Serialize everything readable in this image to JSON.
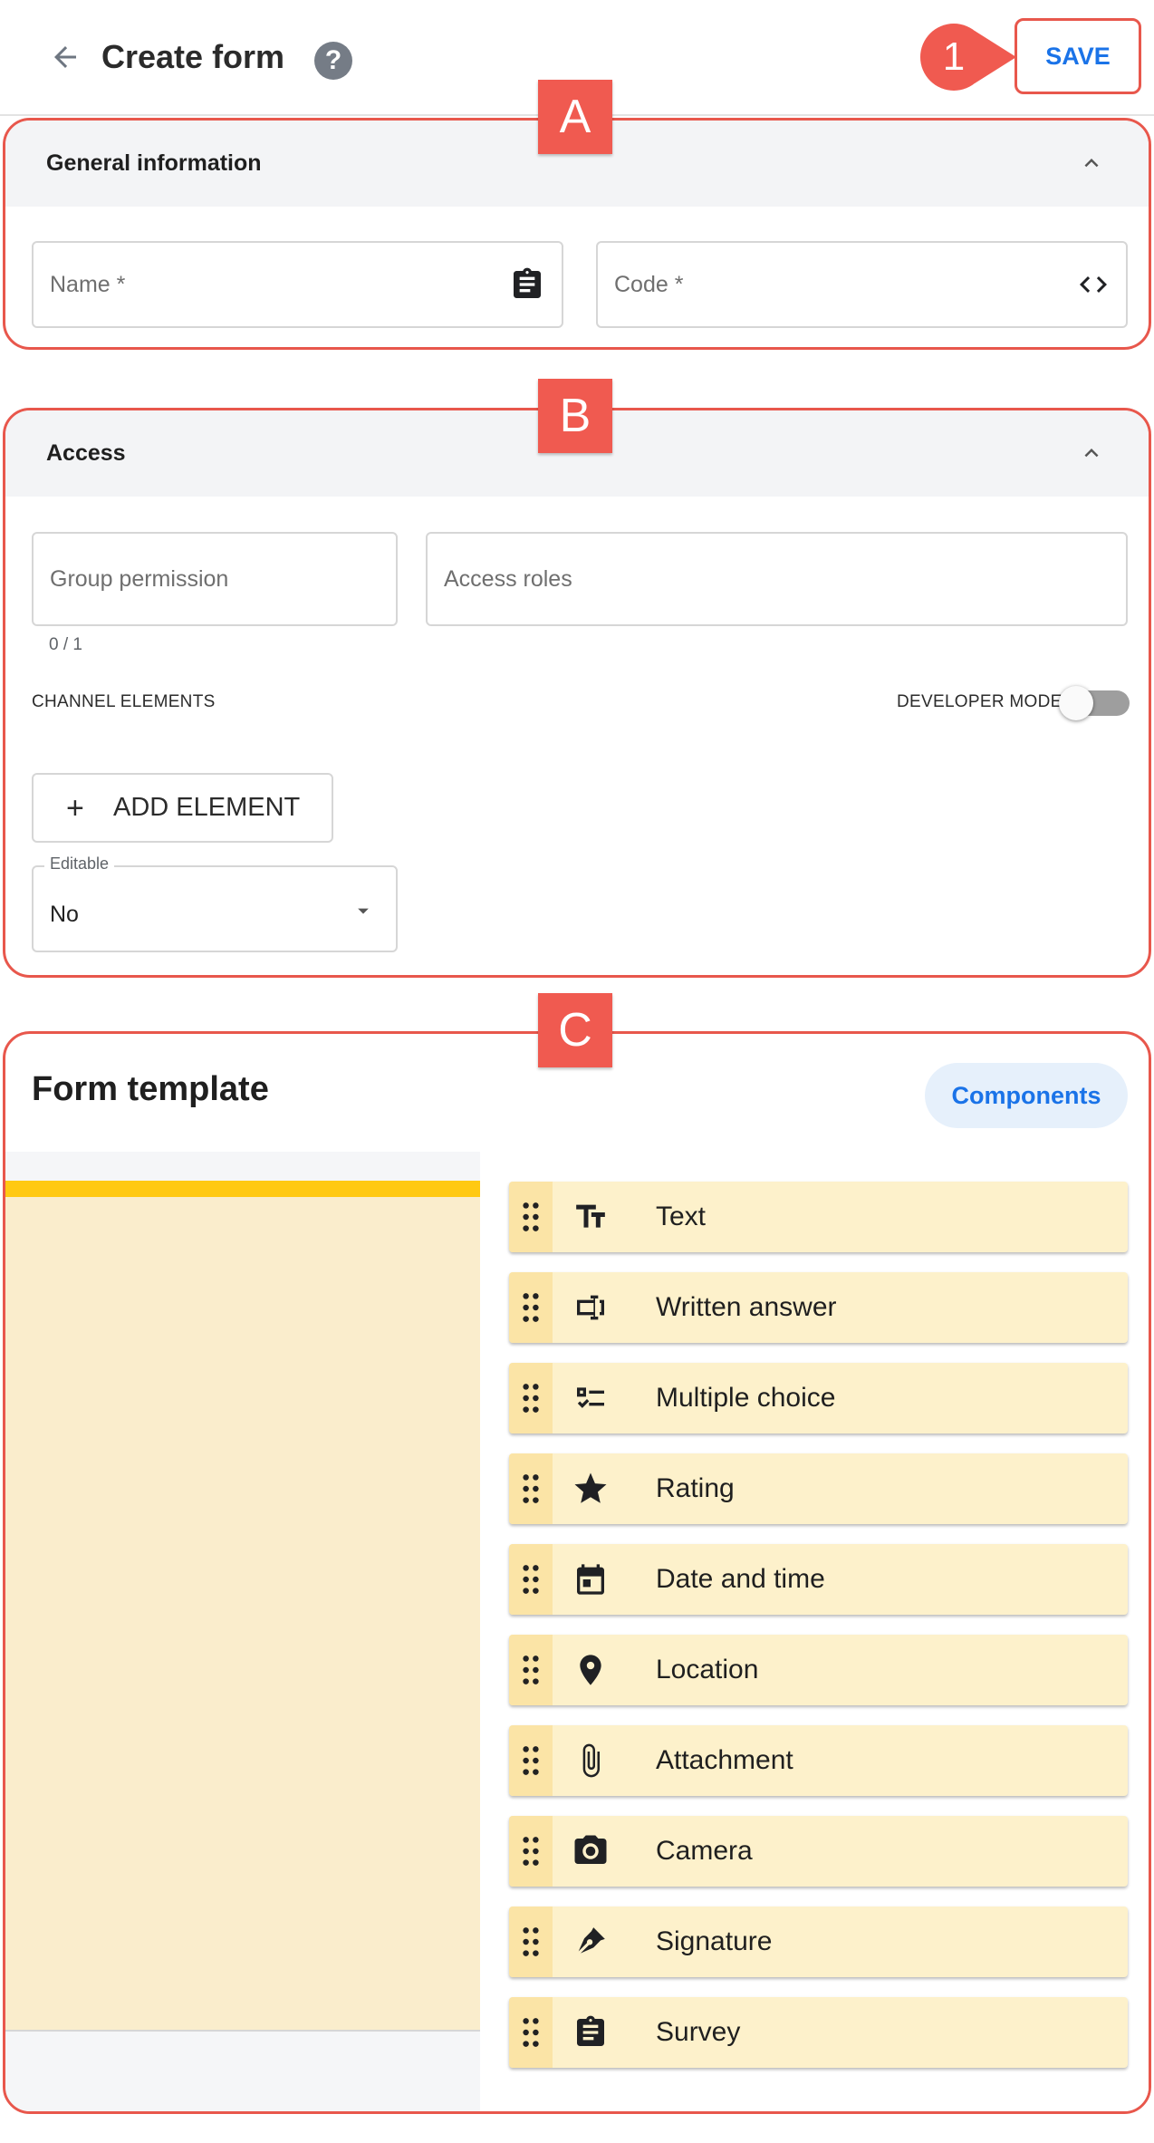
{
  "header": {
    "title": "Create form",
    "help_symbol": "?",
    "save_label": "SAVE",
    "callout_number": "1",
    "icons": {
      "back": "arrow-left-icon",
      "help": "help-circle-icon"
    }
  },
  "tags": {
    "a": "A",
    "b": "B",
    "c": "C"
  },
  "general": {
    "title": "General information",
    "name_placeholder": "Name *",
    "code_placeholder": "Code *",
    "icons": {
      "collapse": "chevron-up-icon",
      "name": "clipboard-icon",
      "code": "code-brackets-icon"
    }
  },
  "access": {
    "title": "Access",
    "group_placeholder": "Group permission",
    "group_counter": "0 / 1",
    "roles_placeholder": "Access roles",
    "channel_elements_label": "CHANNEL ELEMENTS",
    "developer_mode_label": "DEVELOPER MODE",
    "developer_mode_on": false,
    "add_symbol": "+",
    "add_element_label": "ADD ELEMENT",
    "editable": {
      "label": "Editable",
      "value": "No"
    }
  },
  "form_template": {
    "title": "Form template",
    "components_label": "Components",
    "components": [
      {
        "label": "Text",
        "icon": "text-format-icon"
      },
      {
        "label": "Written answer",
        "icon": "text-field-icon"
      },
      {
        "label": "Multiple choice",
        "icon": "checklist-icon"
      },
      {
        "label": "Rating",
        "icon": "star-icon"
      },
      {
        "label": "Date and time",
        "icon": "calendar-icon"
      },
      {
        "label": "Location",
        "icon": "location-pin-icon"
      },
      {
        "label": "Attachment",
        "icon": "paperclip-icon"
      },
      {
        "label": "Camera",
        "icon": "camera-icon"
      },
      {
        "label": "Signature",
        "icon": "pen-nib-icon"
      },
      {
        "label": "Survey",
        "icon": "survey-clipboard-icon"
      }
    ]
  },
  "colors": {
    "annotation_red": "#e8574c",
    "tag_red": "#f05a50",
    "primary_blue": "#1a73e8",
    "component_bg": "#fdf1cb",
    "drop_highlight": "#ffc912"
  }
}
